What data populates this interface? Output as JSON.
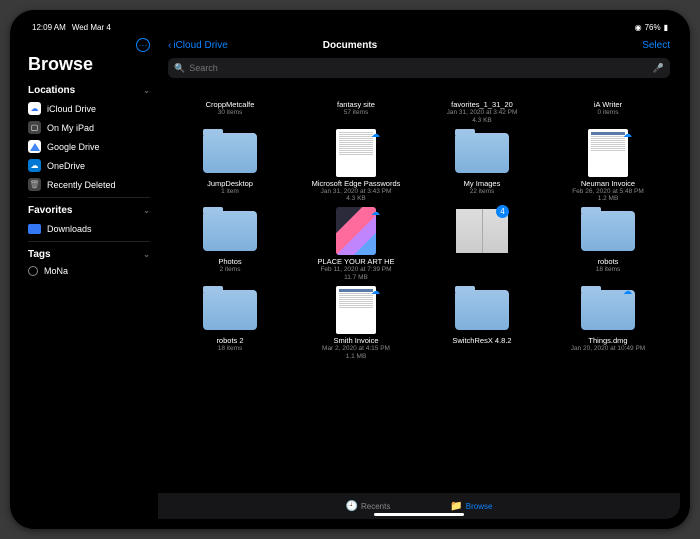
{
  "statusbar": {
    "time": "12:09 AM",
    "date": "Wed Mar 4",
    "battery": "76%"
  },
  "sidebar": {
    "title": "Browse",
    "sections": {
      "locations": {
        "label": "Locations",
        "items": [
          {
            "label": "iCloud Drive"
          },
          {
            "label": "On My iPad"
          },
          {
            "label": "Google Drive"
          },
          {
            "label": "OneDrive"
          },
          {
            "label": "Recently Deleted"
          }
        ]
      },
      "favorites": {
        "label": "Favorites",
        "items": [
          {
            "label": "Downloads"
          }
        ]
      },
      "tags": {
        "label": "Tags",
        "items": [
          {
            "label": "MoNa"
          }
        ]
      }
    }
  },
  "navbar": {
    "back": "iCloud Drive",
    "title": "Documents",
    "select": "Select"
  },
  "search": {
    "placeholder": "Search"
  },
  "items": [
    {
      "name": "CroppMetcalfe",
      "meta": "30 items",
      "meta2": "",
      "type": "folder-slim"
    },
    {
      "name": "fantasy site",
      "meta": "57 items",
      "meta2": "",
      "type": "folder-slim"
    },
    {
      "name": "favorites_1_31_20",
      "meta": "Jan 31, 2020 at 3:42 PM",
      "meta2": "4.3 KB",
      "type": "folder-slim"
    },
    {
      "name": "iA Writer",
      "meta": "0 items",
      "meta2": "",
      "type": "folder-slim"
    },
    {
      "name": "JumpDesktop",
      "meta": "1 item",
      "meta2": "",
      "type": "folder"
    },
    {
      "name": "Microsoft Edge Passwords",
      "meta": "Jan 31, 2020 at 3:43 PM",
      "meta2": "4.3 KB",
      "type": "doc",
      "cloud": true
    },
    {
      "name": "My Images",
      "meta": "22 items",
      "meta2": "",
      "type": "folder"
    },
    {
      "name": "Neuman Invoice",
      "meta": "Feb 26, 2020 at 5:48 PM",
      "meta2": "1.2 MB",
      "type": "invoice",
      "cloud": true
    },
    {
      "name": "Photos",
      "meta": "2 items",
      "meta2": "",
      "type": "folder"
    },
    {
      "name": "PLACE YOUR ART HE",
      "meta": "Feb 11, 2020 at 7:39 PM",
      "meta2": "11.7 MB",
      "type": "photo",
      "cloud": true
    },
    {
      "name": "",
      "meta": "",
      "meta2": "",
      "type": "book",
      "badge": "4"
    },
    {
      "name": "robots",
      "meta": "18 items",
      "meta2": "",
      "type": "folder"
    },
    {
      "name": "robots 2",
      "meta": "18 items",
      "meta2": "",
      "type": "folder"
    },
    {
      "name": "Smith Invoice",
      "meta": "Mar 2, 2020 at 4:15 PM",
      "meta2": "1.1 MB",
      "type": "invoice",
      "cloud": true
    },
    {
      "name": "SwitchResX 4.8.2",
      "meta": "",
      "meta2": "",
      "type": "folder"
    },
    {
      "name": "Things.dmg",
      "meta": "Jan 20, 2020 at 10:49 PM",
      "meta2": "",
      "type": "folder",
      "cloud": true
    }
  ],
  "tabbar": {
    "recents": "Recents",
    "browse": "Browse"
  }
}
